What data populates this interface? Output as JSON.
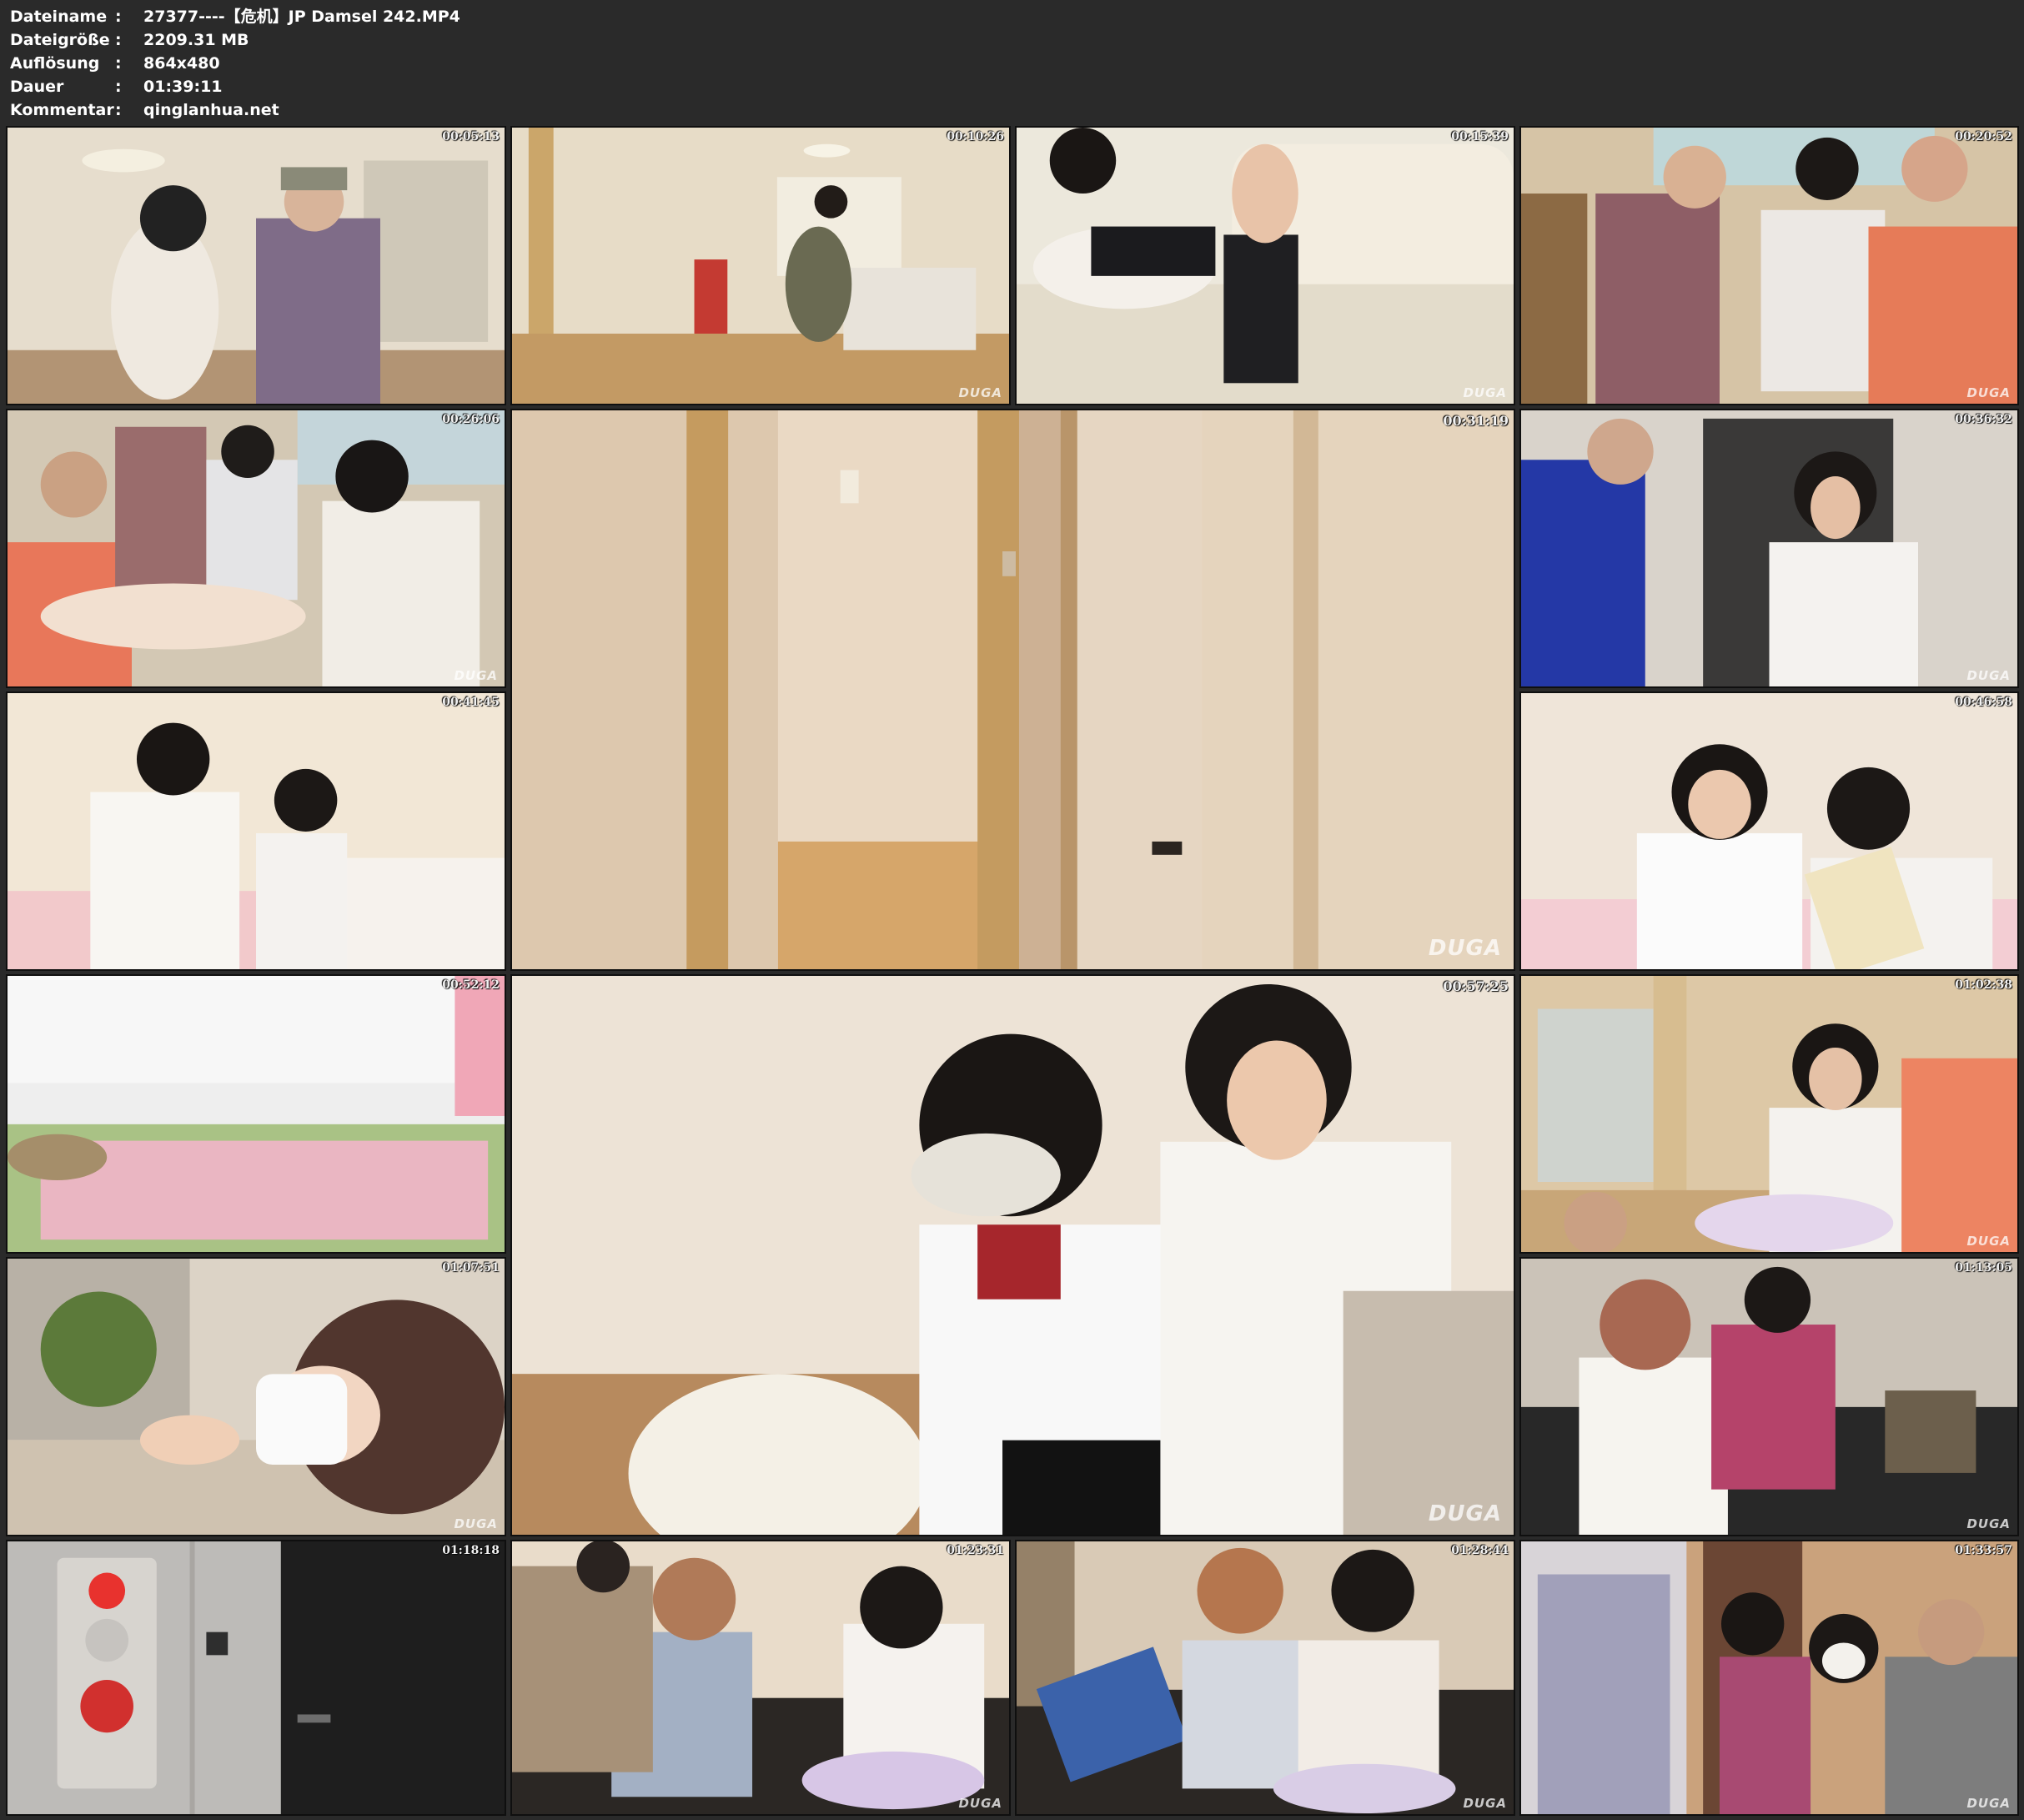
{
  "info": {
    "filename_label": "Dateiname",
    "filename_value": "27377----【危机】JP Damsel 242.MP4",
    "size_label": "Dateigröße",
    "size_value": "2209.31 MB",
    "resolution_label": "Auflösung",
    "resolution_value": "864x480",
    "duration_label": "Dauer",
    "duration_value": "01:39:11",
    "comment_label": "Kommentar",
    "comment_value": "qinglanhua.net",
    "separator": ":"
  },
  "watermark": "DUGA",
  "thumbnails": [
    {
      "time": "00:05:13"
    },
    {
      "time": "00:10:26"
    },
    {
      "time": "00:15:39"
    },
    {
      "time": "00:20:52"
    },
    {
      "time": "00:26:06"
    },
    {
      "time": "00:31:19"
    },
    {
      "time": "00:36:32"
    },
    {
      "time": "00:41:45"
    },
    {
      "time": "00:46:58"
    },
    {
      "time": "00:52:12"
    },
    {
      "time": "00:57:25"
    },
    {
      "time": "01:02:38"
    },
    {
      "time": "01:07:51"
    },
    {
      "time": "01:13:05"
    },
    {
      "time": "01:18:18"
    },
    {
      "time": "01:23:31"
    },
    {
      "time": "01:28:44"
    },
    {
      "time": "01:33:57"
    }
  ]
}
